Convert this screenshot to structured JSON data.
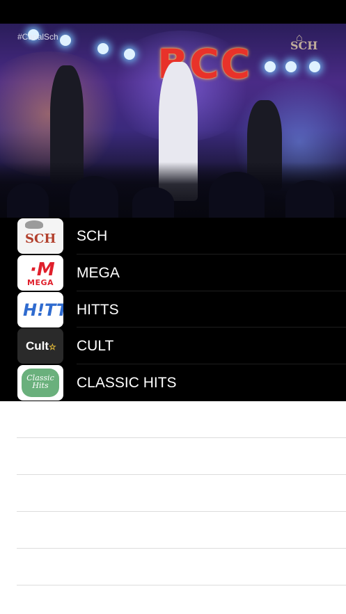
{
  "player": {
    "hashtag": "#CanalSch",
    "stage_sign": "BCC",
    "watermark": "SCH"
  },
  "channels": [
    {
      "name": "SCH",
      "logo_text": "SCH"
    },
    {
      "name": "MEGA",
      "logo_text": "MEGA"
    },
    {
      "name": "HITTS",
      "logo_text": "H!TTS"
    },
    {
      "name": "CULT",
      "logo_text": "Cult"
    },
    {
      "name": "CLASSIC HITS",
      "logo_text": "Classic Hits"
    }
  ],
  "colors": {
    "list_background": "#000000",
    "list_text": "#ffffff",
    "empty_background": "#ffffff",
    "separator": "#dcdcdc"
  }
}
